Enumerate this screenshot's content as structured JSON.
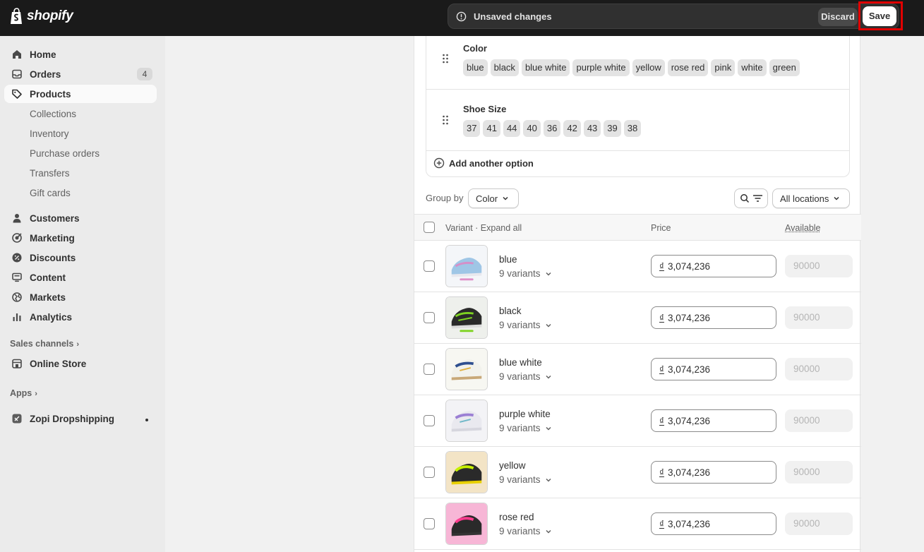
{
  "app": {
    "logo_text": "shopify"
  },
  "savebar": {
    "message": "Unsaved changes",
    "discard_label": "Discard",
    "save_label": "Save"
  },
  "sidebar": {
    "items": [
      {
        "label": "Home",
        "icon": "home-icon"
      },
      {
        "label": "Orders",
        "icon": "inbox-icon",
        "badge": "4"
      },
      {
        "label": "Products",
        "icon": "tag-icon"
      },
      {
        "label": "Customers",
        "icon": "person-icon"
      },
      {
        "label": "Marketing",
        "icon": "target-icon"
      },
      {
        "label": "Discounts",
        "icon": "discount-icon"
      },
      {
        "label": "Content",
        "icon": "monitor-icon"
      },
      {
        "label": "Markets",
        "icon": "globe-icon"
      },
      {
        "label": "Analytics",
        "icon": "bar-chart-icon"
      }
    ],
    "product_subitems": [
      "Collections",
      "Inventory",
      "Purchase orders",
      "Transfers",
      "Gift cards"
    ],
    "sales_channels_label": "Sales channels",
    "online_store_label": "Online Store",
    "apps_label": "Apps",
    "app_item_label": "Zopi Dropshipping"
  },
  "options": [
    {
      "title": "Color",
      "values": [
        "blue",
        "black",
        "blue white",
        "purple white",
        "yellow",
        "rose red",
        "pink",
        "white",
        "green"
      ]
    },
    {
      "title": "Shoe Size",
      "values": [
        "37",
        "41",
        "44",
        "40",
        "36",
        "42",
        "43",
        "39",
        "38"
      ]
    }
  ],
  "add_option_label": "Add another option",
  "group_by": {
    "label": "Group by",
    "value": "Color"
  },
  "locations": {
    "value": "All locations"
  },
  "table": {
    "headers": {
      "variant": "Variant · Expand all",
      "price": "Price",
      "available": "Available"
    },
    "rows": [
      {
        "name": "blue",
        "count": "9 variants",
        "currency": "₫",
        "price": "3,074,236",
        "available": "90000"
      },
      {
        "name": "black",
        "count": "9 variants",
        "currency": "₫",
        "price": "3,074,236",
        "available": "90000"
      },
      {
        "name": "blue white",
        "count": "9 variants",
        "currency": "₫",
        "price": "3,074,236",
        "available": "90000"
      },
      {
        "name": "purple white",
        "count": "9 variants",
        "currency": "₫",
        "price": "3,074,236",
        "available": "90000"
      },
      {
        "name": "yellow",
        "count": "9 variants",
        "currency": "₫",
        "price": "3,074,236",
        "available": "90000"
      },
      {
        "name": "rose red",
        "count": "9 variants",
        "currency": "₫",
        "price": "3,074,236",
        "available": "90000"
      }
    ]
  },
  "colors": {
    "topbar": "#1a1a1a",
    "highlight": "#e10000",
    "sidebar": "#ebebeb"
  }
}
